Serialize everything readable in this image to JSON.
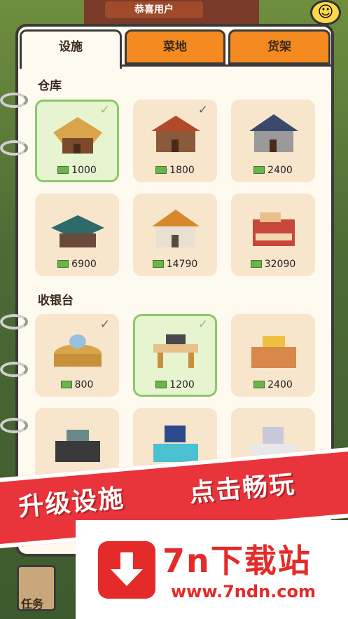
{
  "background": {
    "banner": "恭喜用户"
  },
  "tabs": [
    {
      "label": "设施",
      "active": true
    },
    {
      "label": "菜地",
      "active": false
    },
    {
      "label": "货架",
      "active": false
    }
  ],
  "sections": {
    "warehouse": {
      "title": "仓库",
      "items": [
        {
          "price": "1000",
          "owned": true,
          "selected": true
        },
        {
          "price": "1800",
          "owned": true,
          "selected": false
        },
        {
          "price": "2400",
          "owned": false,
          "selected": false
        },
        {
          "price": "6900",
          "owned": false,
          "selected": false
        },
        {
          "price": "14790",
          "owned": false,
          "selected": false
        },
        {
          "price": "32090",
          "owned": false,
          "selected": false
        }
      ]
    },
    "cashier": {
      "title": "收银台",
      "items": [
        {
          "price": "800",
          "owned": true,
          "selected": false
        },
        {
          "price": "1200",
          "owned": true,
          "selected": true
        },
        {
          "price": "2400",
          "owned": false,
          "selected": false
        }
      ]
    }
  },
  "promo": {
    "left": "升级设施",
    "right": "点击畅玩"
  },
  "watermark": {
    "title": "7n下载站",
    "url": "www.7ndn.com"
  },
  "task_button": {
    "label": "任务"
  },
  "check_glyph": "✓",
  "colors": {
    "tab_orange": "#f48a20",
    "selected_green": "#8cc86a",
    "card_bg": "#f7e6cc",
    "promo_red": "#e8343a"
  }
}
